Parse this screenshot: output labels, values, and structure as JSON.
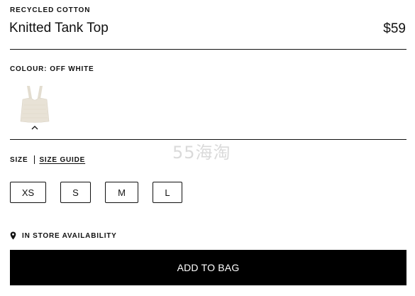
{
  "product": {
    "eyebrow": "RECYCLED COTTON",
    "title": "Knitted Tank Top",
    "price": "$59"
  },
  "colour": {
    "label": "COLOUR:",
    "value": "OFF WHITE",
    "swatch_color": "#e8e2d6"
  },
  "size": {
    "label": "SIZE",
    "guide_label": "SIZE GUIDE",
    "options": [
      "XS",
      "S",
      "M",
      "L"
    ]
  },
  "availability": {
    "label": "IN STORE AVAILABILITY",
    "icon": "location-pin-icon"
  },
  "cta": {
    "add_to_bag": "ADD TO BAG"
  },
  "watermark": "55海淘"
}
